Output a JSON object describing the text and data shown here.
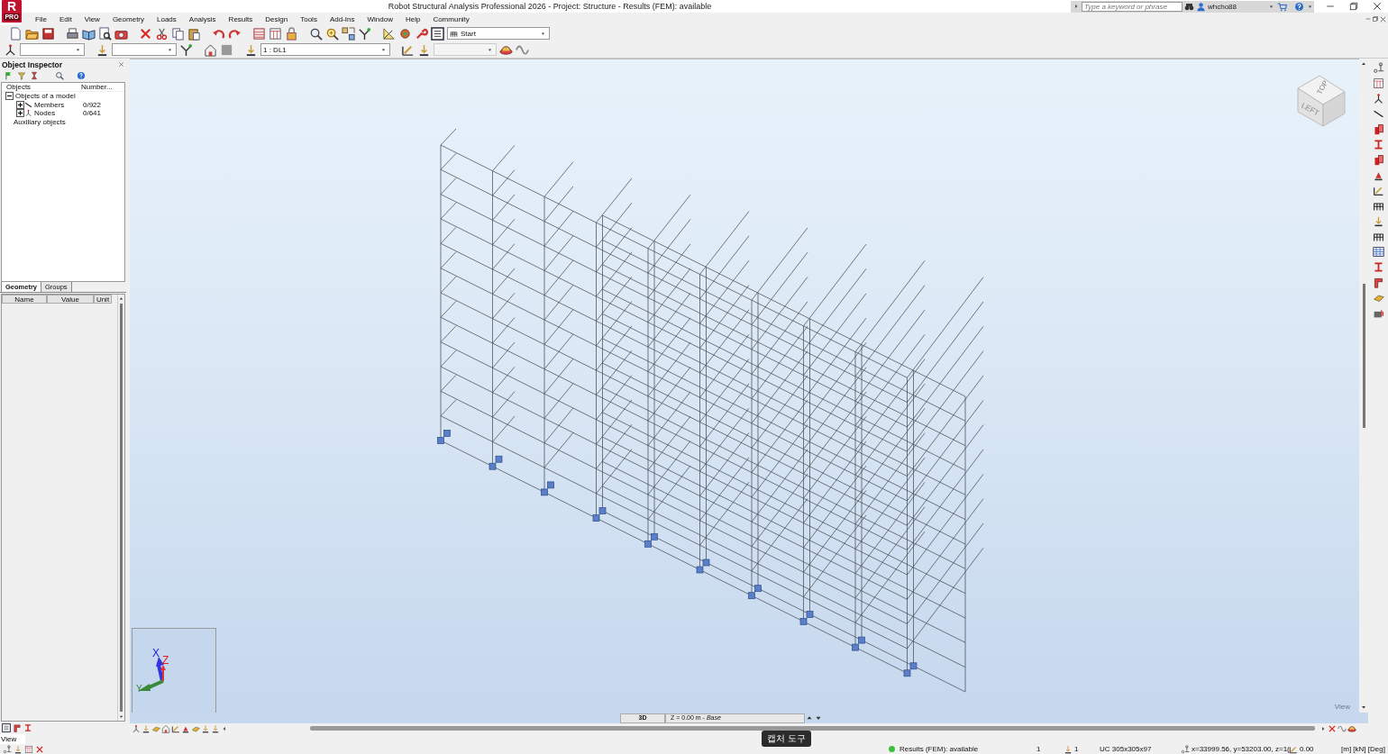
{
  "window": {
    "title": "Robot Structural Analysis Professional 2026 - Project: Structure - Results (FEM): available",
    "logo": {
      "letter": "R",
      "badge": "PRO"
    }
  },
  "search": {
    "placeholder": "Type a keyword or phrase"
  },
  "user": {
    "name": "whcho88"
  },
  "menu": [
    "File",
    "Edit",
    "View",
    "Geometry",
    "Loads",
    "Analysis",
    "Results",
    "Design",
    "Tools",
    "Add-Ins",
    "Window",
    "Help",
    "Community"
  ],
  "toolbar": {
    "layout_select": {
      "value": "Start"
    }
  },
  "toolbar_2": {
    "case_select": {
      "value": "1 : DL1"
    }
  },
  "object_inspector": {
    "title": "Object Inspector",
    "columns": [
      "Objects",
      "Number..."
    ],
    "tree": [
      {
        "label": "Objects of a model",
        "expanded": true,
        "children": [
          {
            "label": "Members",
            "count": "0/922",
            "expanded": false,
            "kind": "members"
          },
          {
            "label": "Nodes",
            "count": "0/641",
            "expanded": false,
            "kind": "nodes"
          }
        ]
      },
      {
        "label": "Auxiliary objects"
      }
    ],
    "tabs": [
      {
        "label": "Geometry",
        "selected": true
      },
      {
        "label": "Groups",
        "selected": false
      }
    ],
    "property_columns": [
      "Name",
      "Value",
      "Unit"
    ]
  },
  "viewport": {
    "view_cube": [
      "TOP",
      "LEFT"
    ],
    "axes": [
      "X",
      "Z",
      "Y"
    ],
    "view_tab": "3D",
    "level": "Z = 0.00 m - *Base*",
    "corner_label": "View"
  },
  "command_line": {
    "value": "View"
  },
  "tooltip": "캡처 도구",
  "status_bar": {
    "results": "Results (FEM): available",
    "results_ok": true,
    "field_1": "1",
    "field_2": "1",
    "section": "UC 305x305x97",
    "coordinates": "x=33999.56, y=53203.00, z=1(",
    "angle": "0.00",
    "units": "[m] [kN] [Deg]"
  }
}
